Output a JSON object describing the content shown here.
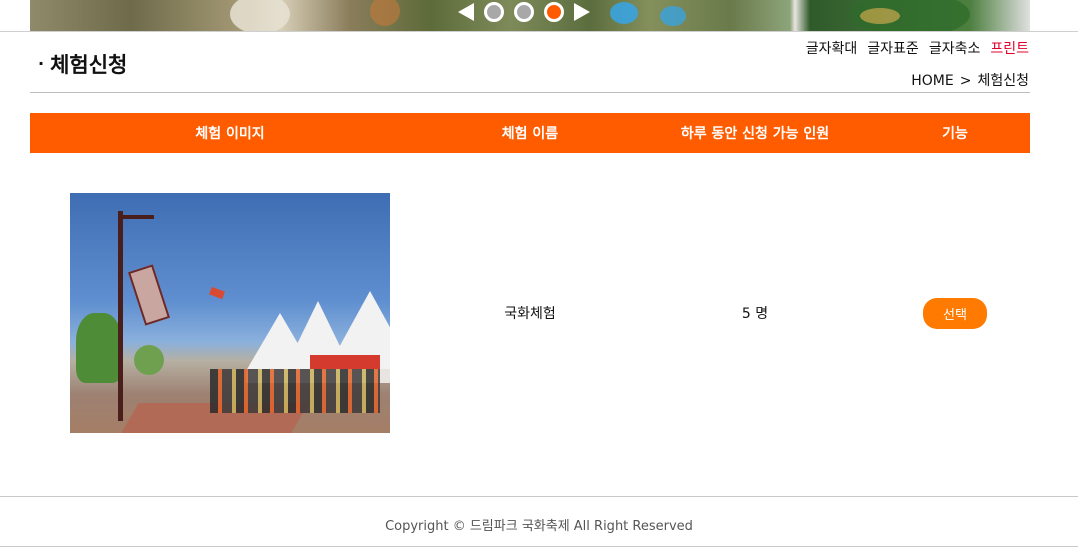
{
  "banner": {
    "slides": [
      {
        "active": false
      },
      {
        "active": false
      },
      {
        "active": true
      }
    ]
  },
  "header": {
    "title": "체험신청",
    "bullet": "·",
    "font_tools": {
      "enlarge": "글자확대",
      "standard": "글자표준",
      "shrink": "글자축소",
      "print": "프린트"
    },
    "breadcrumb": {
      "home": "HOME",
      "separator": ">",
      "current": "체험신청"
    }
  },
  "table": {
    "headers": {
      "image": "체험 이미지",
      "name": "체험 이름",
      "capacity": "하루 동안 신청 가능 인원",
      "function": "기능"
    },
    "rows": [
      {
        "name": "국화체험",
        "capacity": "5 명",
        "action": "선택"
      }
    ]
  },
  "footer": {
    "copyright": "Copyright © 드림파크 국화축제 All Right Reserved"
  },
  "colors": {
    "accent": "#ff5c00",
    "button": "#ff7a00",
    "print_link": "#e0002a"
  }
}
